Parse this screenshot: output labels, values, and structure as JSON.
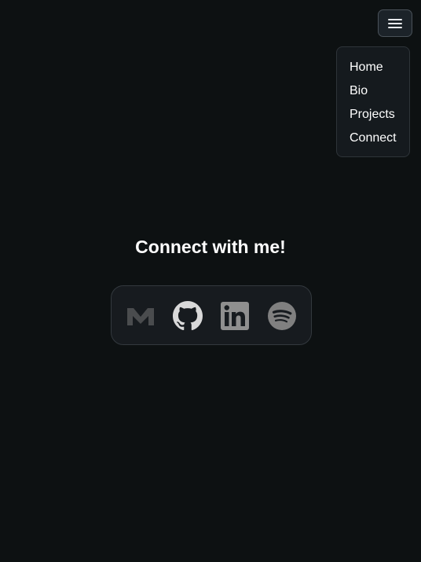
{
  "nav": {
    "menu_icon": "hamburger-menu-icon",
    "items": [
      {
        "label": "Home"
      },
      {
        "label": "Bio"
      },
      {
        "label": "Projects"
      },
      {
        "label": "Connect"
      }
    ]
  },
  "main": {
    "heading": "Connect with me!"
  },
  "social": {
    "links": [
      {
        "icon": "gmail-icon",
        "color": "#4a4c4e"
      },
      {
        "icon": "github-icon",
        "color": "#d9d9d9"
      },
      {
        "icon": "linkedin-icon",
        "color": "#8f8f8f"
      },
      {
        "icon": "spotify-icon",
        "color": "#808080"
      }
    ]
  },
  "colors": {
    "background": "#0d1112",
    "card": "#171b1f",
    "text": "#ffffff"
  }
}
